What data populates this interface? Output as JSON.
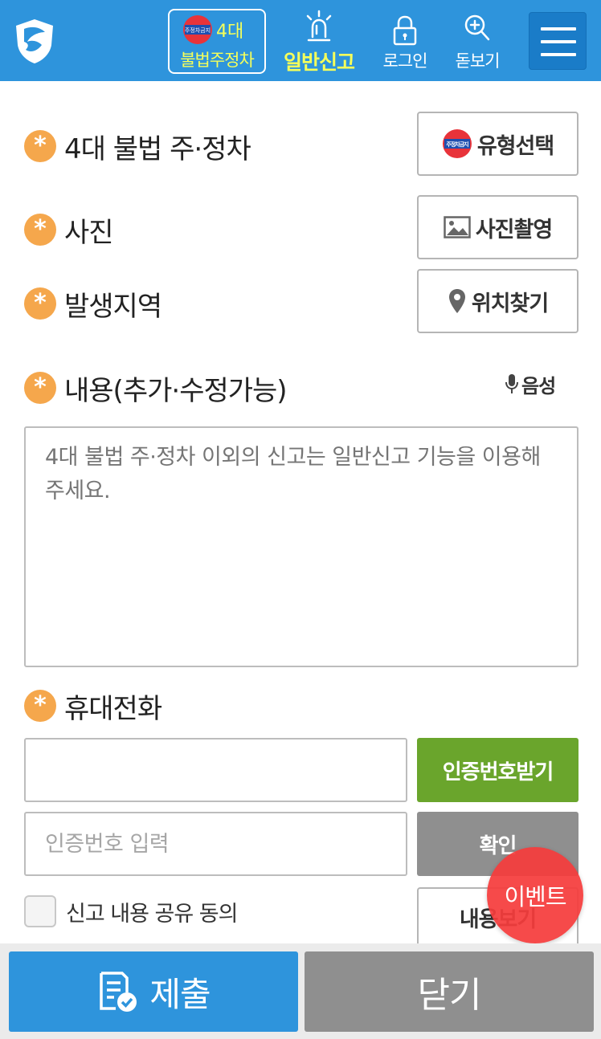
{
  "header": {
    "illegal_parking": {
      "badge_text": "주정차금지",
      "line1": "4대",
      "line2": "불법주정차"
    },
    "general_report": {
      "label": "일반신고"
    },
    "login": {
      "label": "로그인"
    },
    "zoom": {
      "label": "돋보기"
    },
    "menu_icon": "hamburger-menu-icon",
    "colors": {
      "bar": "#2e94dc",
      "highlight": "#f5ff5a"
    }
  },
  "form": {
    "type_row": {
      "label": "4대 불법 주·정차",
      "button": "유형선택",
      "button_badge": "주정차금지"
    },
    "photo_row": {
      "label": "사진",
      "button": "사진촬영"
    },
    "location_row": {
      "label": "발생지역",
      "button": "위치찾기"
    },
    "content_row": {
      "label": "내용(추가·수정가능)",
      "voice": "음성",
      "placeholder": "4대 불법 주·정차 이외의 신고는 일반신고 기능을 이용해주세요.",
      "value": ""
    },
    "phone_row": {
      "label": "휴대전화",
      "phone_value": "",
      "request_button": "인증번호받기",
      "code_placeholder": "인증번호 입력",
      "confirm_button": "확인"
    },
    "share": {
      "label": "신고 내용 공유 동의",
      "checked": false,
      "view_button": "내용보기"
    },
    "required_mark": "*"
  },
  "event_fab": {
    "label": "이벤트"
  },
  "footer": {
    "submit": "제출",
    "close": "닫기"
  }
}
